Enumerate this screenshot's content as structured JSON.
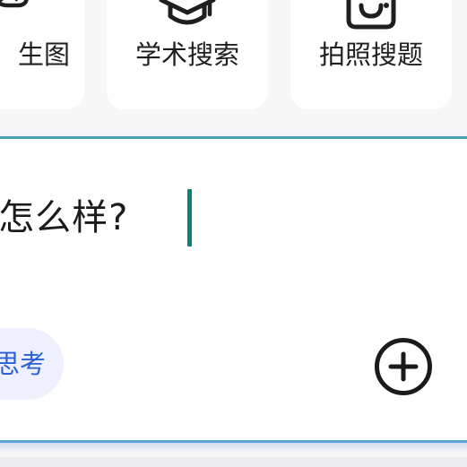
{
  "shortcuts": [
    {
      "label": "生图",
      "icon": "image-icon"
    },
    {
      "label": "学术搜索",
      "icon": "graduation-cap-icon"
    },
    {
      "label": "拍照搜题",
      "icon": "camera-icon"
    }
  ],
  "composer": {
    "input_text": "i怎么样?",
    "deep_think_label": "思考",
    "add_icon": "plus-circle-icon"
  },
  "colors": {
    "accent_teal": "#0e8077",
    "chip_text_blue": "#2a5fd8",
    "chip_bg": "#eef1fd",
    "border_teal": "#4aa0b0"
  }
}
